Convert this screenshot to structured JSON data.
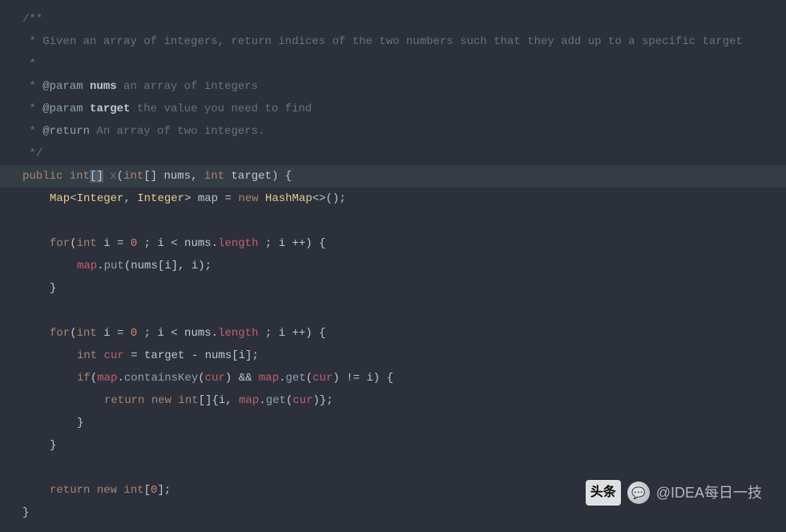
{
  "code": {
    "l1": "/**",
    "l2_pre": " * ",
    "l2_text": "Given an array of integers, return indices of the two numbers such that they add up to a specific target",
    "l3": " *",
    "l4_pre": " * ",
    "l4_tag": "@param",
    "l4_name": " nums",
    "l4_desc": " an array of integers",
    "l5_pre": " * ",
    "l5_tag": "@param",
    "l5_name": " target",
    "l5_desc": " the value you need to find",
    "l6_pre": " * ",
    "l6_tag": "@return",
    "l6_desc": " An array of two integers.",
    "l7": " */",
    "l8_public": "public ",
    "l8_int": "int",
    "l8_br1": "[",
    "l8_br2": "]",
    "l8_x": " x",
    "l8_lp": "(",
    "l8_int2": "int",
    "l8_arr": "[] ",
    "l8_nums": "nums",
    "l8_comma": ", ",
    "l8_int3": "int ",
    "l8_target": "target",
    "l8_rp": ") {",
    "l9_map": "Map",
    "l9_lt": "<",
    "l9_integer1": "Integer",
    "l9_c1": ", ",
    "l9_integer2": "Integer",
    "l9_gt": "> ",
    "l9_mapvar": "map",
    "l9_eq": " = ",
    "l9_new": "new ",
    "l9_hashmap": "HashMap",
    "l9_diamond": "<>();",
    "l11_for": "for",
    "l11_lp": "(",
    "l11_int": "int ",
    "l11_i": "i = ",
    "l11_zero": "0",
    "l11_semi1": " ; i < nums.",
    "l11_length": "length",
    "l11_rest": " ; i ++) {",
    "l12_map": "map",
    "l12_dot": ".",
    "l12_put": "put",
    "l12_args": "(nums[i], i);",
    "l13": "}",
    "l15_for": "for",
    "l15_lp": "(",
    "l15_int": "int ",
    "l15_i": "i = ",
    "l15_zero": "0",
    "l15_semi1": " ; i < nums.",
    "l15_length": "length",
    "l15_rest": " ; i ++) {",
    "l16_int": "int ",
    "l16_cur": "cur",
    "l16_rest": " = target - nums[i];",
    "l17_if": "if",
    "l17_lp": "(",
    "l17_map1": "map",
    "l17_d1": ".",
    "l17_ck": "containsKey",
    "l17_lp2": "(",
    "l17_cur1": "cur",
    "l17_rp1": ") && ",
    "l17_map2": "map",
    "l17_d2": ".",
    "l17_get": "get",
    "l17_lp3": "(",
    "l17_cur2": "cur",
    "l17_rp2": ") != i) {",
    "l18_return": "return ",
    "l18_new": "new ",
    "l18_int": "int",
    "l18_br": "[]{i, ",
    "l18_map": "map",
    "l18_d": ".",
    "l18_get": "get",
    "l18_lp": "(",
    "l18_cur": "cur",
    "l18_rp": ")};",
    "l19": "}",
    "l20": "}",
    "l22_return": "return ",
    "l22_new": "new ",
    "l22_int": "int",
    "l22_br": "[",
    "l22_zero": "0",
    "l22_end": "];",
    "l23": "}"
  },
  "watermark": {
    "logo_text": "头条",
    "handle": "@IDEA每日一技"
  }
}
